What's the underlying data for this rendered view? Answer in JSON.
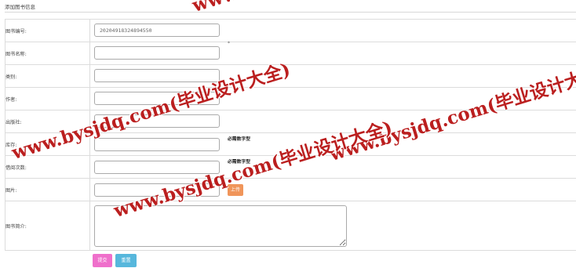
{
  "header": {
    "title": "添加图书信息"
  },
  "form": {
    "rows": [
      {
        "label": "图书编号:",
        "value": "20204918324894550",
        "placeholder": ""
      },
      {
        "label": "图书名称:",
        "value": "",
        "required_mark": "*"
      },
      {
        "label": "类别:",
        "value": ""
      },
      {
        "label": "作者:",
        "value": ""
      },
      {
        "label": "出版社:",
        "value": ""
      },
      {
        "label": "库存:",
        "value": "",
        "hint": "必需数字型"
      },
      {
        "label": "借阅次数:",
        "value": "",
        "hint": "必需数字型"
      },
      {
        "label": "图片:",
        "value": "",
        "upload_label": "上传"
      },
      {
        "label": "图书简介:",
        "value": ""
      }
    ]
  },
  "actions": {
    "submit_label": "提交",
    "reset_label": "重置"
  },
  "colors": {
    "upload": "#f0955a",
    "submit": "#ef6fcb",
    "reset": "#57b7dc",
    "watermark": "#b81414"
  },
  "watermark": {
    "text": "www.bysjdq.com(毕业设计大全)"
  }
}
